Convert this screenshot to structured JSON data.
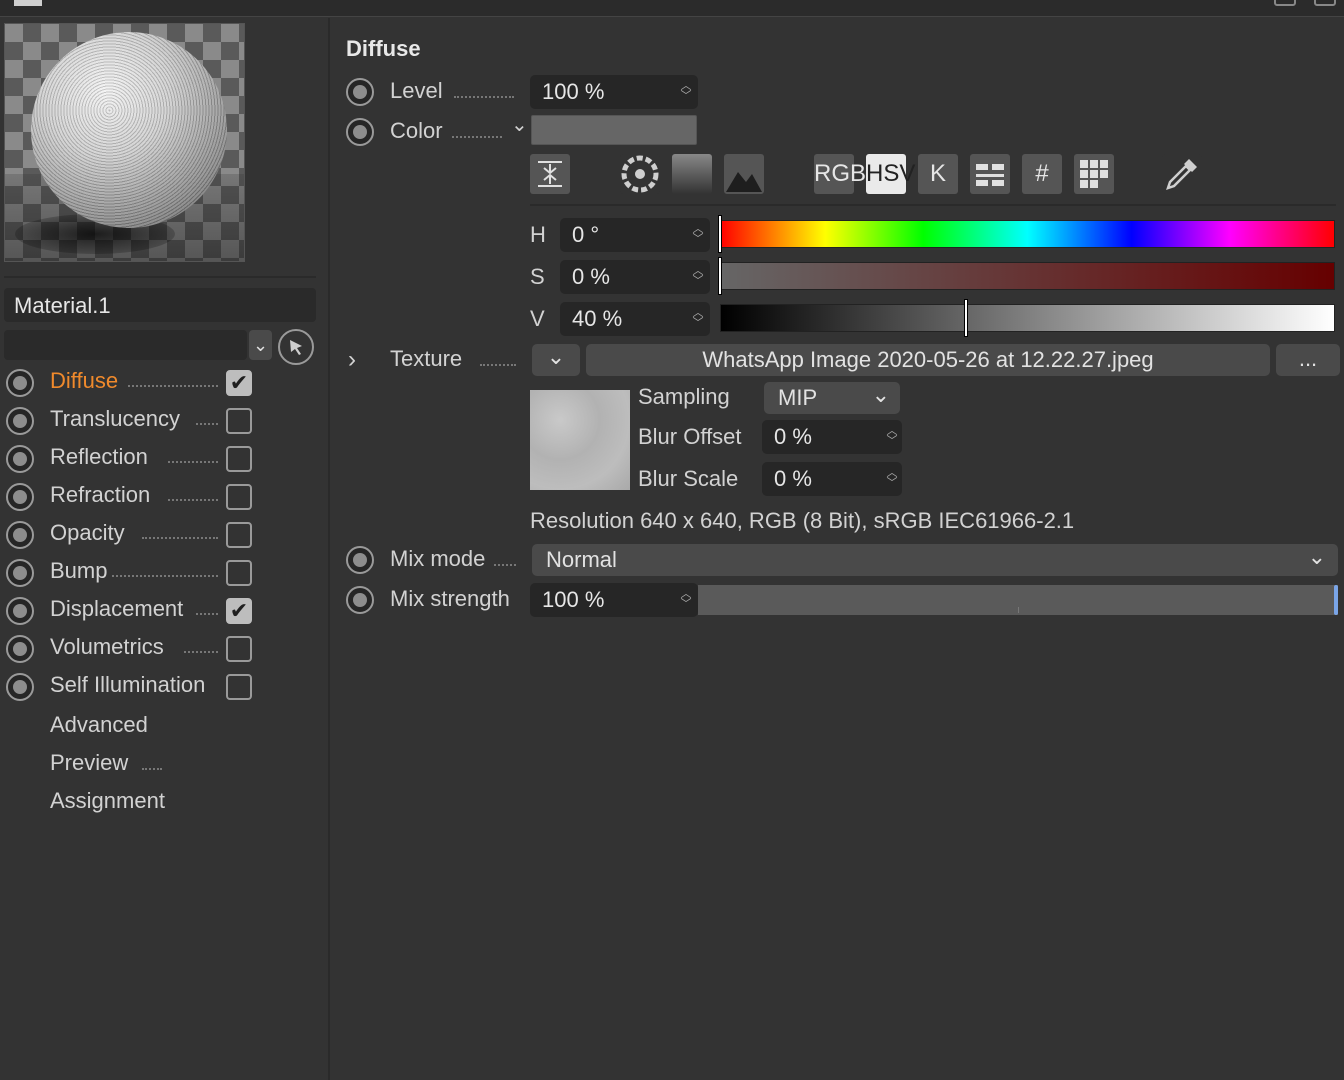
{
  "left_panel": {
    "material_name": "Material.1",
    "channels": [
      {
        "label": "Diffuse",
        "checked": true,
        "active": true
      },
      {
        "label": "Translucency",
        "checked": false
      },
      {
        "label": "Reflection",
        "checked": false
      },
      {
        "label": "Refraction",
        "checked": false
      },
      {
        "label": "Opacity",
        "checked": false
      },
      {
        "label": "Bump",
        "checked": false
      },
      {
        "label": "Displacement",
        "checked": true
      },
      {
        "label": "Volumetrics",
        "checked": false
      },
      {
        "label": "Self Illumination",
        "checked": false
      }
    ],
    "extra_items": [
      "Advanced",
      "Preview",
      "Assignment"
    ],
    "check_mark": "✔"
  },
  "diffuse": {
    "title": "Diffuse",
    "level_label": "Level",
    "level_value": "100 %",
    "color_label": "Color",
    "color_swatch": "#666666",
    "color_tools": {
      "rgb": "RGB",
      "hsv": "HSV",
      "kelvin": "K",
      "hex": "#"
    },
    "hsv": {
      "h_label": "H",
      "h_value": "0 °",
      "s_label": "S",
      "s_value": "0 %",
      "v_label": "V",
      "v_value": "40 %",
      "v_level": 0.4
    },
    "texture_label": "Texture",
    "texture_file": "WhatsApp Image 2020-05-26 at 12.22.27.jpeg",
    "texture_more": "...",
    "sampling_label": "Sampling",
    "sampling_value": "MIP",
    "blur_offset_label": "Blur Offset",
    "blur_offset_value": "0 %",
    "blur_scale_label": "Blur Scale",
    "blur_scale_value": "0 %",
    "resolution": "Resolution 640 x 640, RGB (8 Bit), sRGB IEC61966-2.1",
    "mix_mode_label": "Mix mode",
    "mix_mode_value": "Normal",
    "mix_strength_label": "Mix strength",
    "mix_strength_value": "100 %",
    "mix_strength_level": 1.0
  },
  "colors": {
    "active_channel": "#f08a2c",
    "panel_bg": "#333333",
    "field_bg": "#262626"
  },
  "icons": {
    "chevron_down": "⌄",
    "chevron_right": "›"
  }
}
